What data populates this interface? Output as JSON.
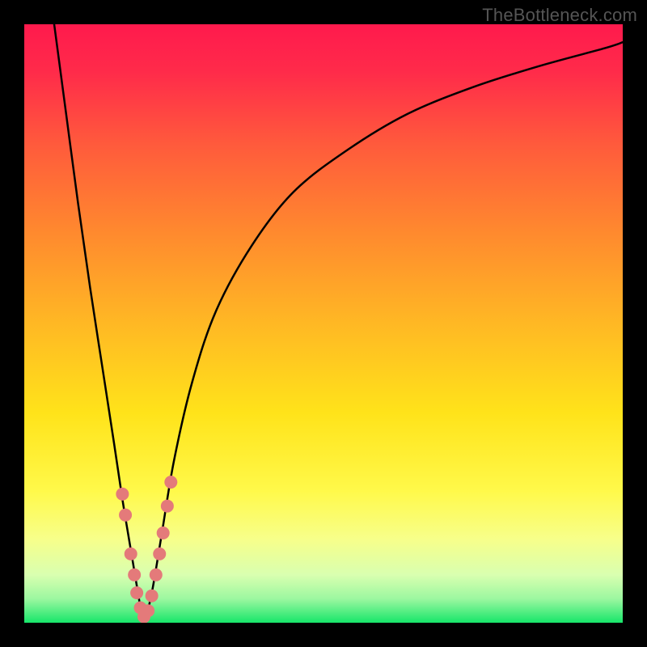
{
  "watermark": "TheBottleneck.com",
  "chart_data": {
    "type": "line",
    "title": "",
    "xlabel": "",
    "ylabel": "",
    "xlim": [
      0,
      100
    ],
    "ylim": [
      0,
      100
    ],
    "gradient_stops": [
      {
        "offset": 0.0,
        "color": "#ff1a4d"
      },
      {
        "offset": 0.08,
        "color": "#ff2b4a"
      },
      {
        "offset": 0.2,
        "color": "#ff5a3c"
      },
      {
        "offset": 0.35,
        "color": "#ff8a2e"
      },
      {
        "offset": 0.5,
        "color": "#ffb824"
      },
      {
        "offset": 0.65,
        "color": "#ffe31a"
      },
      {
        "offset": 0.78,
        "color": "#fff94a"
      },
      {
        "offset": 0.86,
        "color": "#f7ff8a"
      },
      {
        "offset": 0.92,
        "color": "#d9ffb0"
      },
      {
        "offset": 0.96,
        "color": "#9cf7a0"
      },
      {
        "offset": 1.0,
        "color": "#17e66a"
      }
    ],
    "series": [
      {
        "name": "bottleneck-curve",
        "color": "#000000",
        "x": [
          5,
          7,
          9,
          11,
          13,
          15,
          16.5,
          18,
          19,
          19.6,
          20.0,
          20.5,
          21.5,
          23,
          25,
          28,
          32,
          38,
          45,
          54,
          64,
          75,
          86,
          97,
          100
        ],
        "y": [
          100,
          85,
          70,
          56,
          43,
          30,
          20,
          11,
          5,
          1.5,
          0.5,
          1.5,
          6,
          15,
          27,
          40,
          52,
          63,
          72,
          79,
          85,
          89.5,
          93,
          96,
          97
        ]
      }
    ],
    "markers": {
      "name": "data-dots",
      "color": "#e47a7a",
      "radius_px": 8,
      "points": [
        {
          "x": 16.4,
          "y": 21.5
        },
        {
          "x": 16.9,
          "y": 18.0
        },
        {
          "x": 17.8,
          "y": 11.5
        },
        {
          "x": 18.4,
          "y": 8.0
        },
        {
          "x": 18.8,
          "y": 5.0
        },
        {
          "x": 19.4,
          "y": 2.5
        },
        {
          "x": 20.0,
          "y": 1.0
        },
        {
          "x": 20.7,
          "y": 2.0
        },
        {
          "x": 21.3,
          "y": 4.5
        },
        {
          "x": 22.0,
          "y": 8.0
        },
        {
          "x": 22.6,
          "y": 11.5
        },
        {
          "x": 23.2,
          "y": 15.0
        },
        {
          "x": 23.9,
          "y": 19.5
        },
        {
          "x": 24.5,
          "y": 23.5
        }
      ]
    }
  }
}
